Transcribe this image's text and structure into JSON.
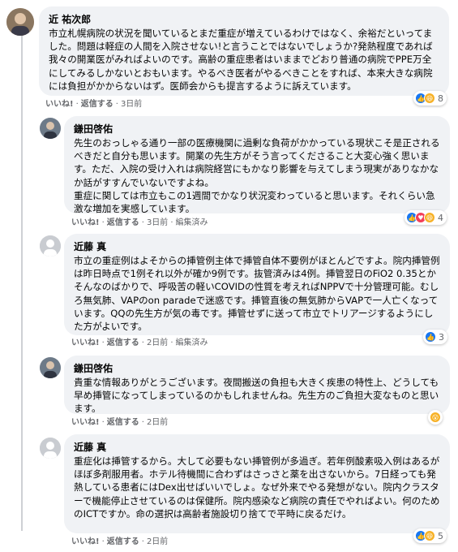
{
  "comments": [
    {
      "name": "近 祐次郎",
      "text": "市立札幌病院の状況を聞いているとまだ重症が増えているわけではなく、余裕だといってました。問題は軽症の人間を入院させない!と言うことではないでしょうか?発熱程度であれば我々の開業医がみればよいのです。高齢の重症患者はいままでどおり普通の病院でPPE万全にしてみるしかないとおもいます。やるべき医者がやるべきことをすれば、本来大きな病院には負担がかからないはず。医師会からも提言するように訴えています。",
      "like": "いいね!",
      "reply": "返信する",
      "time": "3日前",
      "edited": "",
      "reaction_count": "8",
      "reactions": [
        "like-icon",
        "haha-icon"
      ]
    },
    {
      "name": "鎌田啓佑",
      "text": "先生のおっしゃる通り一部の医療機関に過剰な負荷がかかっている現状こそ是正されるべきだと自分も思います。開業の先生方がそう言ってくださること大変心強く思います。ただ、入院の受け入れは病院経営にもかなり影響を与えてしまう現実がありなかなか話がすすんでいないですよね。\n重症に関しては市立もこの1週間でかなり状況変わっていると思います。それくらい急激な増加を実感しています。",
      "like": "いいね!",
      "reply": "返信する",
      "time": "3日前",
      "edited": "編集済み",
      "reaction_count": "4",
      "reactions": [
        "like-icon",
        "love-icon",
        "haha-icon"
      ]
    },
    {
      "name": "近藤 真",
      "text": "市立の重症例はよそからの挿管例主体で挿管自体不要例がほとんどですよ。院内挿管例は昨日時点で1例それ以外が確か9例です。抜管済みは4例。挿管翌日のFiO2 0.35とかそんなのばかりで、呼吸苦の軽いCOVIDの性質を考えればNPPVで十分管理可能。むしろ無気肺、VAPのon paradeで迷惑です。挿管直後の無気肺からVAPで一人亡くなっています。QQの先生方が気の毒です。挿管せずに送って市立でトリアージするようにした方がよいです。",
      "like": "いいね!",
      "reply": "返信する",
      "time": "2日前",
      "edited": "編集済み",
      "reaction_count": "3",
      "reactions": [
        "like-icon"
      ]
    },
    {
      "name": "鎌田啓佑",
      "text": "貴重な情報ありがとうございます。夜間搬送の負担も大きく疾患の特性上、どうしても早め挿管になってしまっているのかもしれませんね。先生方のご負担大変なものと思います。",
      "like": "いいね!",
      "reply": "返信する",
      "time": "2日前",
      "edited": "",
      "reaction_count": "",
      "reactions": [
        "wow-icon"
      ]
    },
    {
      "name": "近藤 真",
      "text": "重症化は挿管するから。大して必要もない挿管例が多過ぎ。若年例酸素吸入例はあるがほぼ多剤服用者。ホテル待機間に合わずはさっさと薬を出さないから。7日経っても発熱している患者にはDex出せばいいでしょ。なぜ外来でやる発想がない。院内クラスターで機能停止させているのは保健所。院内感染など病院の責任でやればよい。何のためのICTですか。命の選択は高齢者施設切り捨てで平時に戻るだけ。",
      "like": "いいね!",
      "reply": "返信する",
      "time": "2日前",
      "edited": "",
      "reaction_count": "5",
      "reactions": [
        "like-icon",
        "haha-icon"
      ]
    }
  ]
}
